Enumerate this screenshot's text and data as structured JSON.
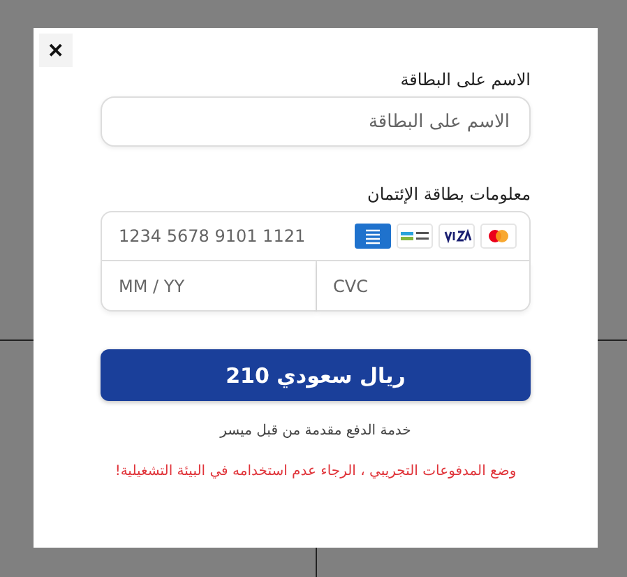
{
  "close_button": {
    "label": "✕"
  },
  "name_field": {
    "label": "الاسم على البطاقة",
    "placeholder": "الاسم على البطاقة"
  },
  "card_field": {
    "label": "معلومات بطاقة الإئتمان",
    "number_placeholder": "1234 5678 9101 1121",
    "expiry_placeholder": "MM / YY",
    "cvc_placeholder": "CVC",
    "brands": [
      {
        "kind": "amex"
      },
      {
        "kind": "mada"
      },
      {
        "kind": "visa"
      },
      {
        "kind": "mastercard"
      }
    ]
  },
  "pay_button": {
    "label": "210 ريال سعودي"
  },
  "provider_note": "خدمة الدفع مقدمة من قبل ميسر",
  "test_warning": "وضع المدفوعات التجريبي ، الرجاء عدم استخدامه في البيئة التشغيلية!"
}
